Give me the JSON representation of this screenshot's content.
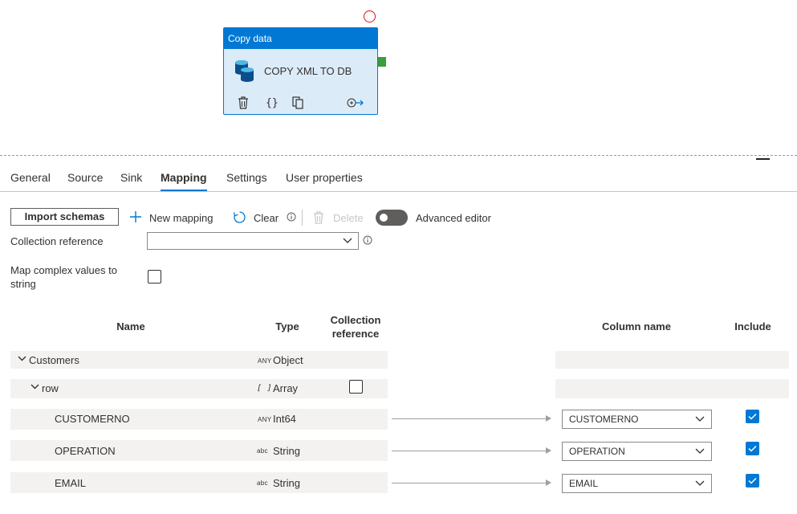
{
  "activity": {
    "type_label": "Copy data",
    "name": "COPY XML TO DB",
    "actions": [
      "delete-icon",
      "code-icon",
      "copy-icon",
      "add-output-icon"
    ]
  },
  "tabs": [
    {
      "label": "General",
      "active": false
    },
    {
      "label": "Source",
      "active": false
    },
    {
      "label": "Sink",
      "active": false
    },
    {
      "label": "Mapping",
      "active": true
    },
    {
      "label": "Settings",
      "active": false
    },
    {
      "label": "User properties",
      "active": false
    }
  ],
  "toolbar": {
    "import_schemas": "Import schemas",
    "new_mapping": "New mapping",
    "clear": "Clear",
    "delete": "Delete",
    "advanced_editor": "Advanced editor",
    "advanced_editor_on": false
  },
  "collection_reference": {
    "label": "Collection reference",
    "value": ""
  },
  "map_complex": {
    "label_line1": "Map complex values to",
    "label_line2": "string",
    "checked": false
  },
  "table": {
    "headers": {
      "name": "Name",
      "type": "Type",
      "collection_ref_line1": "Collection",
      "collection_ref_line2": "reference",
      "column_name": "Column name",
      "include": "Include"
    },
    "rows": [
      {
        "name": "Customers",
        "type_tag": "ANY",
        "type": "Object"
      },
      {
        "name": "row",
        "type_tag": "[ ]",
        "type": "Array",
        "collection_checked": false
      },
      {
        "name": "CUSTOMERNO",
        "type_tag": "ANY",
        "type": "Int64",
        "column": "CUSTOMERNO",
        "include": true
      },
      {
        "name": "OPERATION",
        "type_tag": "abc",
        "type": "String",
        "column": "OPERATION",
        "include": true
      },
      {
        "name": "EMAIL",
        "type_tag": "abc",
        "type": "String",
        "column": "EMAIL",
        "include": true
      }
    ]
  },
  "colors": {
    "accent": "#0078d4",
    "activity_bg": "#dcebf8",
    "error_ring": "#e00b1c",
    "success_handle": "#3b9d3b"
  }
}
